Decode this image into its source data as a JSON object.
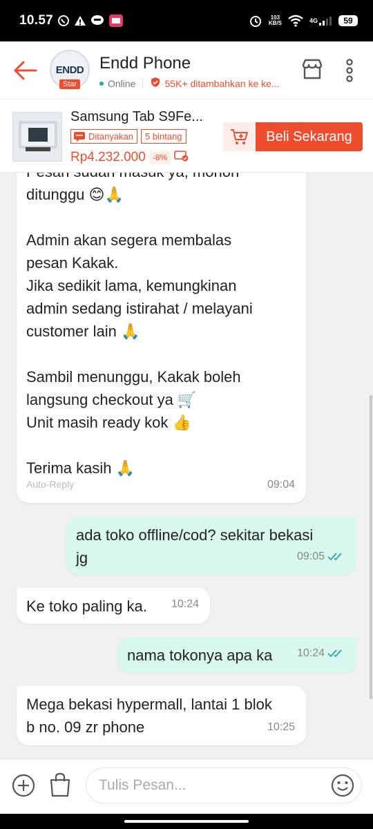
{
  "status_bar": {
    "time": "10.57",
    "net_speed_value": "103",
    "net_speed_unit": "KB/S",
    "network_type": "4G",
    "battery": "59"
  },
  "header": {
    "shop_name": "Endd Phone",
    "avatar_logo": "ENDD",
    "badge": "Star",
    "status": "Online",
    "followers": "55K+ ditambahkan ke ke..."
  },
  "product": {
    "name": "Samsung Tab S9Fe...",
    "tag_asked": "Ditanyakan",
    "tag_rating": "5 bintang",
    "price": "Rp4.232.000",
    "discount": "-8%",
    "buy_label": "Beli Sekarang"
  },
  "messages": [
    {
      "direction": "in",
      "text": "Pesan sudah masuk ya, mohon\nditunggu 😊🙏\n\nAdmin akan segera membalas\npesan Kakak.\nJika sedikit lama, kemungkinan\nadmin sedang istirahat / melayani\ncustomer lain 🙏\n\nSambil menunggu, Kakak boleh\nlangsung checkout ya 🛒\nUnit masih ready kok 👍\n\nTerima kasih 🙏",
      "label": "Auto-Reply",
      "time": "09:04"
    },
    {
      "direction": "out",
      "text": "ada toko offline/cod? sekitar bekasi\njg",
      "time": "09:05",
      "read": true
    },
    {
      "direction": "in",
      "text": "Ke toko paling ka.",
      "time": "10:24"
    },
    {
      "direction": "out",
      "text": "nama tokonya apa ka",
      "time": "10:24",
      "read": true
    },
    {
      "direction": "in",
      "text": "Mega bekasi hypermall, lantai 1 blok\nb no. 09 zr phone",
      "time": "10:25"
    }
  ],
  "composer": {
    "placeholder": "Tulis Pesan..."
  },
  "colors": {
    "accent": "#ee4d2d",
    "outgoing_bubble": "#d8f7ef",
    "read_tick": "#26aa99"
  }
}
